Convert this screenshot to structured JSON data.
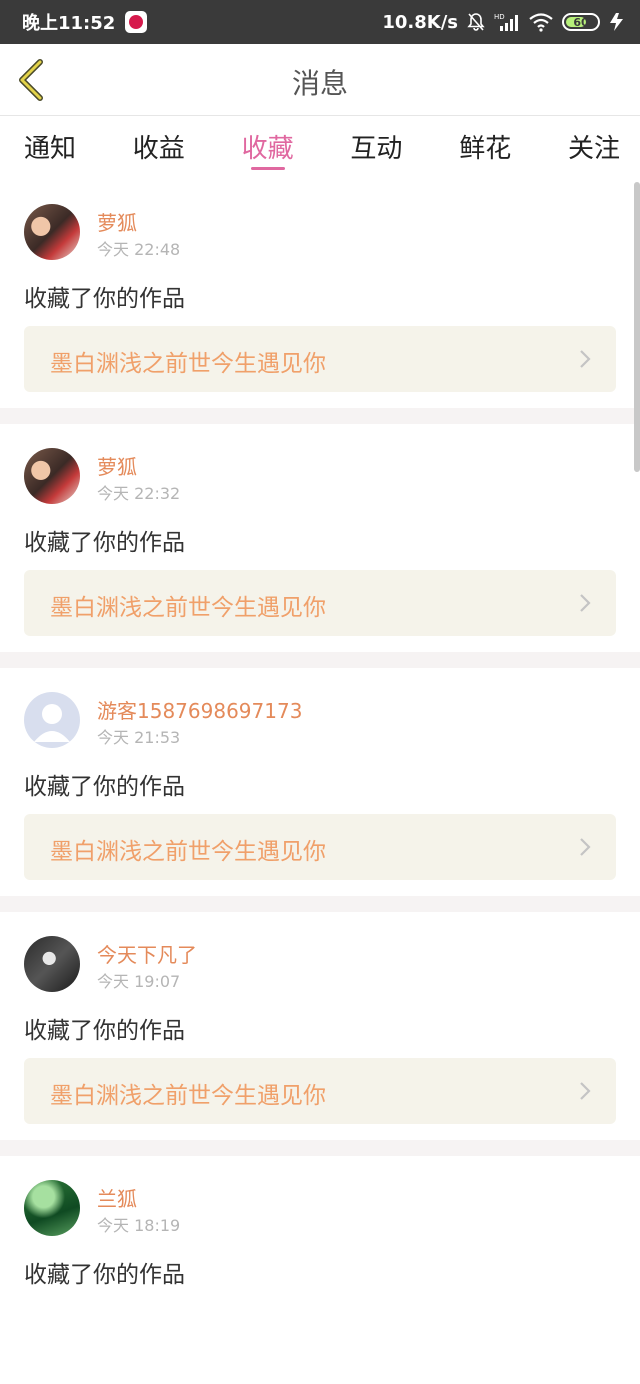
{
  "status_bar": {
    "time": "晚上11:52",
    "network_speed": "10.8K/s",
    "battery": "60",
    "app_icon": "app-notification-icon"
  },
  "header": {
    "title": "消息",
    "back_icon": "back-arrow-icon"
  },
  "tabs": [
    {
      "label": "通知",
      "active": false
    },
    {
      "label": "收益",
      "active": false
    },
    {
      "label": "收藏",
      "active": true
    },
    {
      "label": "互动",
      "active": false
    },
    {
      "label": "鲜花",
      "active": false
    },
    {
      "label": "关注",
      "active": false
    }
  ],
  "messages": [
    {
      "user": "萝狐",
      "time": "今天 22:48",
      "action": "收藏了你的作品",
      "work": "墨白渊浅之前世今生遇见你",
      "avatar": "photo"
    },
    {
      "user": "萝狐",
      "time": "今天 22:32",
      "action": "收藏了你的作品",
      "work": "墨白渊浅之前世今生遇见你",
      "avatar": "photo"
    },
    {
      "user": "游客1587698697173",
      "time": "今天 21:53",
      "action": "收藏了你的作品",
      "work": "墨白渊浅之前世今生遇见你",
      "avatar": "guest"
    },
    {
      "user": "今天下凡了",
      "time": "今天 19:07",
      "action": "收藏了你的作品",
      "work": "墨白渊浅之前世今生遇见你",
      "avatar": "dark"
    },
    {
      "user": "兰狐",
      "time": "今天 18:19",
      "action": "收藏了你的作品",
      "work": "",
      "avatar": "green"
    }
  ],
  "colors": {
    "accent": "#e068a0",
    "username": "#e48a5a",
    "work_title": "#f0a06a",
    "work_bg": "#f5f3ea"
  }
}
